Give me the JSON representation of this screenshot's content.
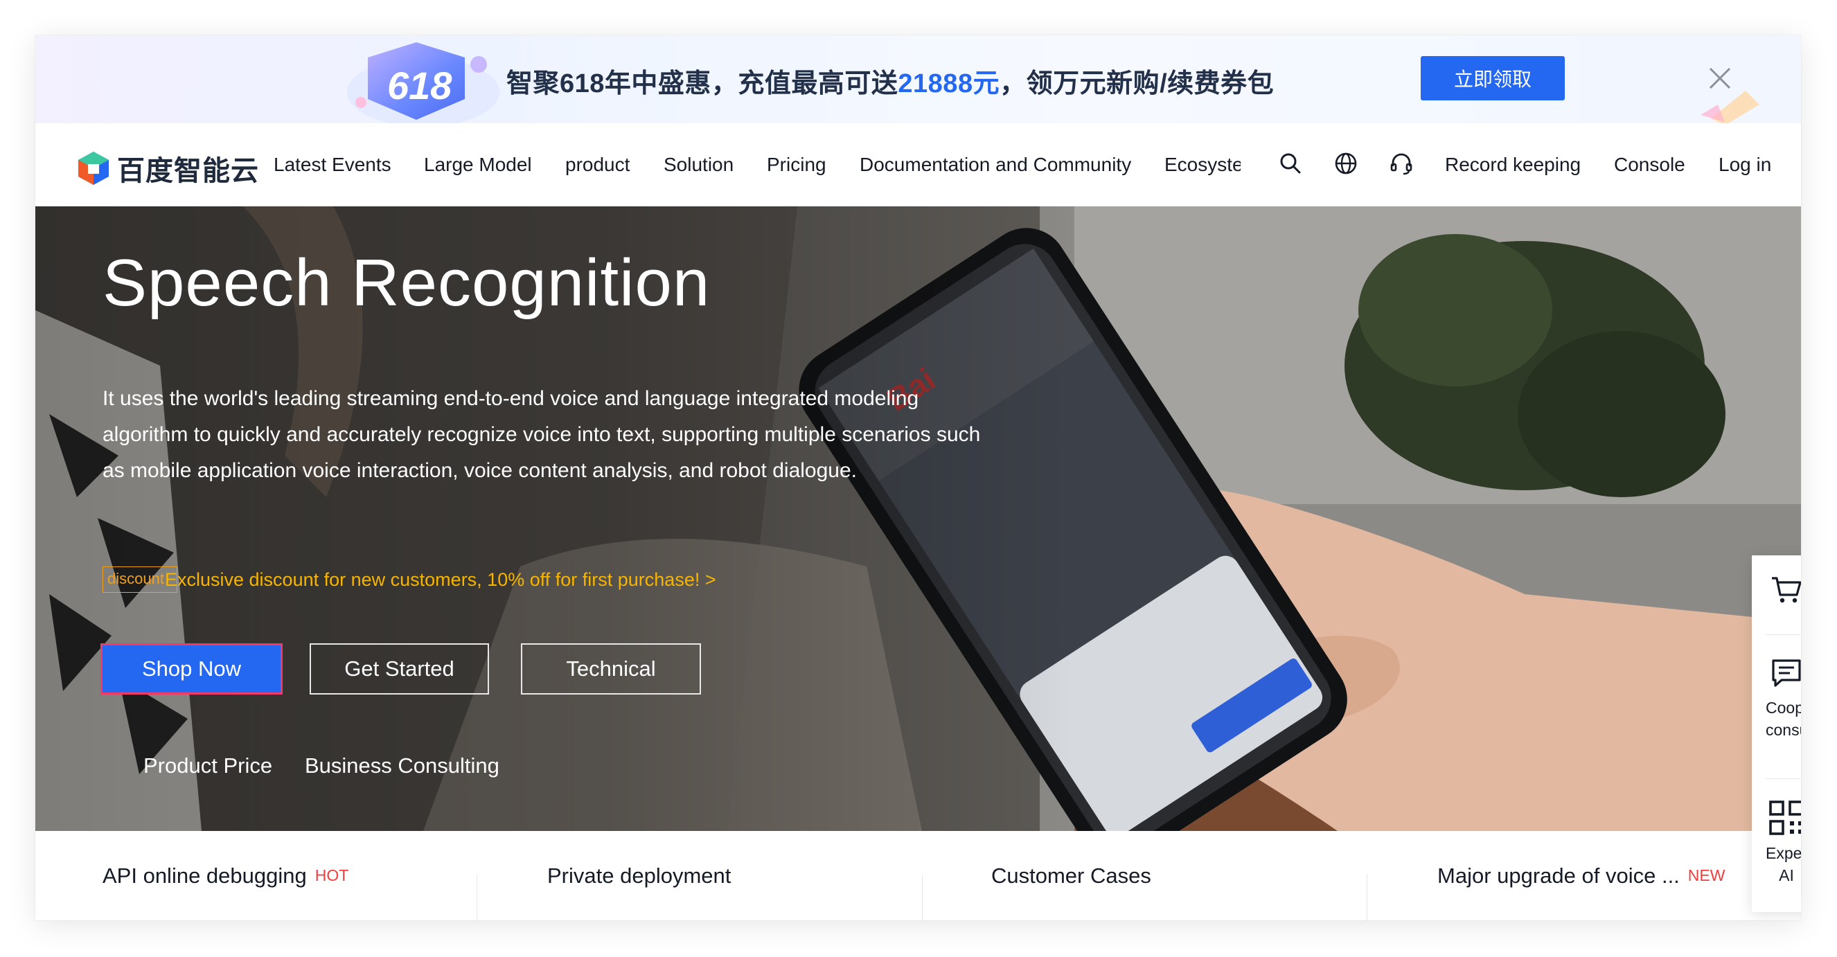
{
  "promo": {
    "text_before": "智聚618年中盛惠，充值最高可送",
    "text_highlight": "21888元",
    "text_after": "，领万元新购/续费券包",
    "badge_number": "618",
    "button_label": "立即领取",
    "colors": {
      "accent": "#2468f2"
    }
  },
  "nav": {
    "logo_text": "百度智能云",
    "items": [
      "Latest Events",
      "Large Model",
      "product",
      "Solution",
      "Pricing",
      "Documentation and Community",
      "Ecosyste"
    ],
    "icons": [
      "search-icon",
      "globe-icon",
      "headset-icon"
    ],
    "right_items": [
      "Record keeping",
      "Console",
      "Log in"
    ]
  },
  "hero": {
    "title": "Speech Recognition",
    "description": "It uses the world's leading streaming end-to-end voice and language integrated modeling algorithm to quickly and accurately recognize voice into text, supporting multiple scenarios such as mobile application voice interaction, voice content analysis, and robot dialogue.",
    "discount_tag": "discount",
    "discount_text": "Exclusive discount for new customers, 10% off for first purchase! >",
    "buttons": {
      "primary": "Shop Now",
      "get_started": "Get Started",
      "technical": "Technical"
    },
    "links": [
      "Product Price",
      "Business Consulting"
    ]
  },
  "tabs": [
    {
      "label": "API online debugging",
      "badge": "HOT"
    },
    {
      "label": "Private deployment",
      "badge": ""
    },
    {
      "label": "Customer Cases",
      "badge": ""
    },
    {
      "label": "Major upgrade of voice ...",
      "badge": "NEW"
    }
  ],
  "side_panel": {
    "items": [
      {
        "icon": "cart-icon",
        "label": ""
      },
      {
        "icon": "chat-icon",
        "label_line1": "Coopera",
        "label_line2": "consulta"
      },
      {
        "icon": "qrcode-icon",
        "label_line1": "Experien",
        "label_line2": "AI"
      }
    ]
  }
}
